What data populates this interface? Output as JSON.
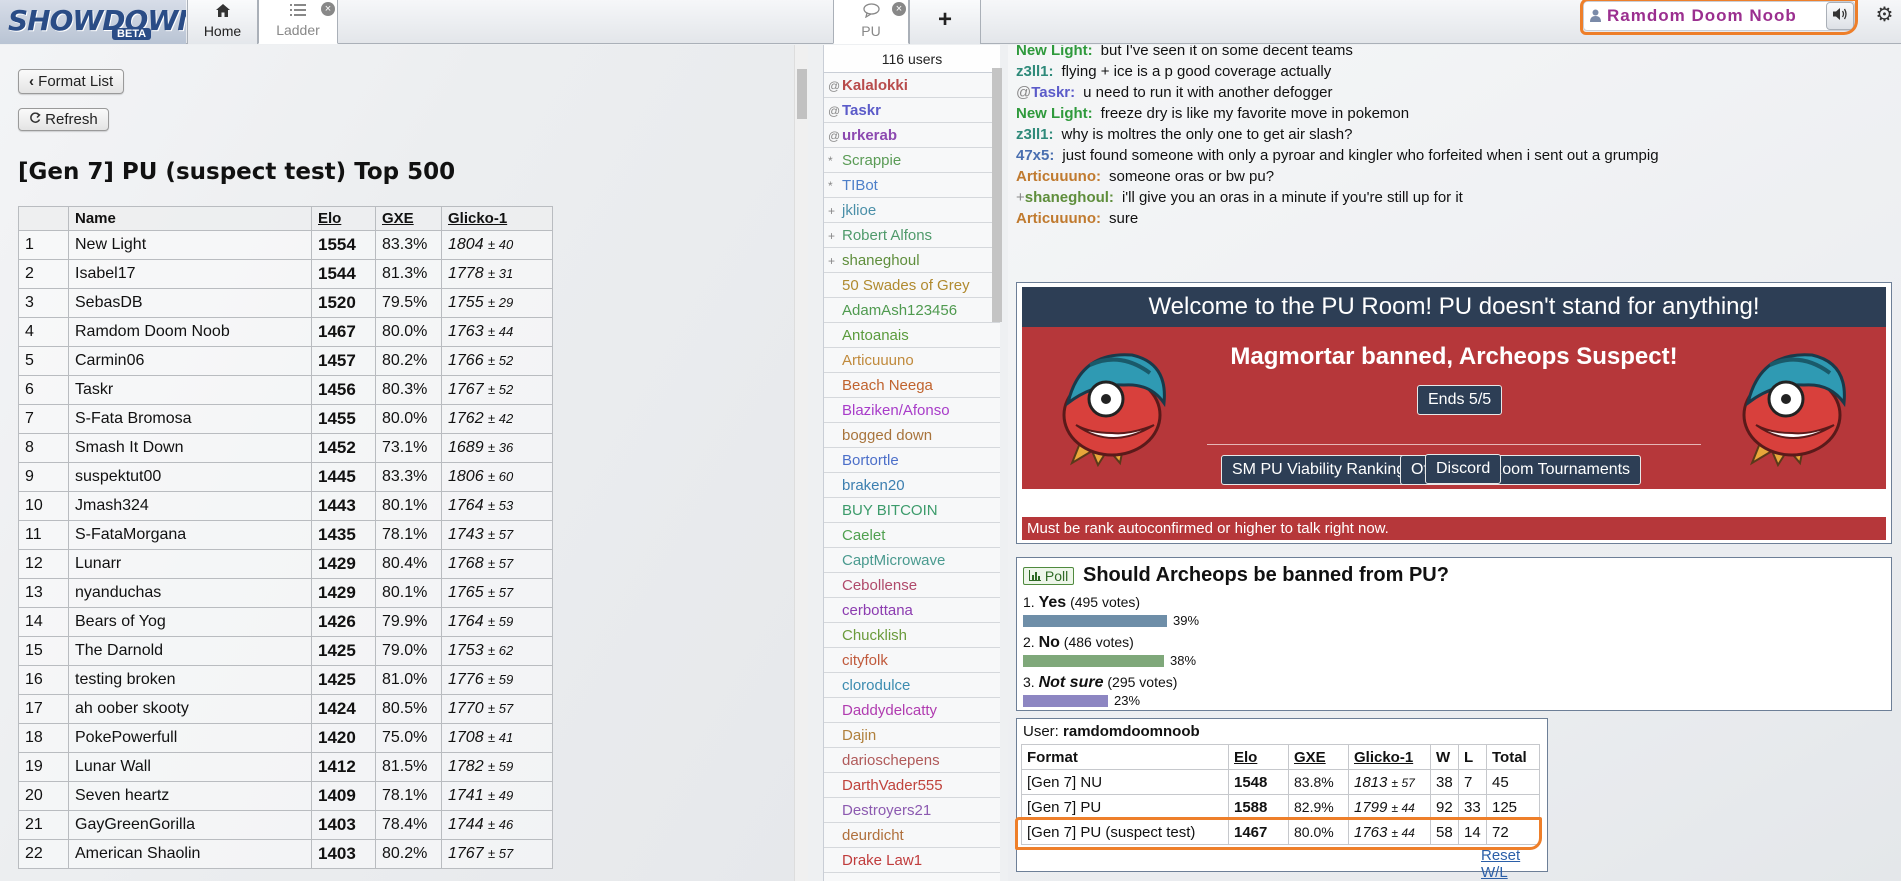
{
  "topbar": {
    "logo_text": "SHOWDOWN",
    "logo_beta": "BETA",
    "tabs": [
      {
        "label": "Home",
        "icon": "home-icon"
      },
      {
        "label": "Ladder",
        "icon": "list-icon"
      },
      {
        "label": "PU",
        "icon": "chat-bubble-icon"
      }
    ],
    "new_tab": "+",
    "user_name": "Ramdom Doom Noob",
    "volume_glyph": "🔊",
    "settings_glyph": "⚙"
  },
  "ladder": {
    "format_list_label": "Format List",
    "refresh_label": "Refresh",
    "title": "[Gen 7] PU (suspect test) Top 500",
    "headers": [
      "",
      "Name",
      "Elo",
      "GXE",
      "Glicko-1"
    ],
    "rows": [
      [
        "1",
        "New Light",
        "1554",
        "83.3%",
        "1804",
        "± 40"
      ],
      [
        "2",
        "Isabel17",
        "1544",
        "81.3%",
        "1778",
        "± 31"
      ],
      [
        "3",
        "SebasDB",
        "1520",
        "79.5%",
        "1755",
        "± 29"
      ],
      [
        "4",
        "Ramdom Doom Noob",
        "1467",
        "80.0%",
        "1763",
        "± 44"
      ],
      [
        "5",
        "Carmin06",
        "1457",
        "80.2%",
        "1766",
        "± 52"
      ],
      [
        "6",
        "Taskr",
        "1456",
        "80.3%",
        "1767",
        "± 52"
      ],
      [
        "7",
        "S-Fata Bromosa",
        "1455",
        "80.0%",
        "1762",
        "± 42"
      ],
      [
        "8",
        "Smash It Down",
        "1452",
        "73.1%",
        "1689",
        "± 36"
      ],
      [
        "9",
        "suspektut00",
        "1445",
        "83.3%",
        "1806",
        "± 60"
      ],
      [
        "10",
        "Jmash324",
        "1443",
        "80.1%",
        "1764",
        "± 53"
      ],
      [
        "11",
        "S-FataMorgana",
        "1435",
        "78.1%",
        "1743",
        "± 57"
      ],
      [
        "12",
        "Lunarr",
        "1429",
        "80.4%",
        "1768",
        "± 57"
      ],
      [
        "13",
        "nyanduchas",
        "1429",
        "80.1%",
        "1765",
        "± 57"
      ],
      [
        "14",
        "Bears of Yog",
        "1426",
        "79.9%",
        "1764",
        "± 59"
      ],
      [
        "15",
        "The Darnold",
        "1425",
        "79.0%",
        "1753",
        "± 62"
      ],
      [
        "16",
        "testing broken",
        "1425",
        "81.0%",
        "1776",
        "± 59"
      ],
      [
        "17",
        "ah oober skooty",
        "1424",
        "80.5%",
        "1770",
        "± 57"
      ],
      [
        "18",
        "PokePowerfull",
        "1420",
        "75.0%",
        "1708",
        "± 41"
      ],
      [
        "19",
        "Lunar Wall",
        "1412",
        "81.5%",
        "1782",
        "± 59"
      ],
      [
        "20",
        "Seven heartz",
        "1409",
        "78.1%",
        "1741",
        "± 49"
      ],
      [
        "21",
        "GayGreenGorilla",
        "1403",
        "78.4%",
        "1744",
        "± 46"
      ],
      [
        "22",
        "American Shaolin",
        "1403",
        "80.2%",
        "1767",
        "± 57"
      ]
    ]
  },
  "userlist": {
    "count": "116 users",
    "users": [
      {
        "rank": "@",
        "name": "Kalalokki",
        "color": "#b84c4c",
        "staff": true
      },
      {
        "rank": "@",
        "name": "Taskr",
        "color": "#5b5bc9",
        "staff": true
      },
      {
        "rank": "@",
        "name": "urkerab",
        "color": "#8c49b0",
        "staff": true
      },
      {
        "rank": "*",
        "name": "Scrappie",
        "color": "#5a9b55",
        "staff": false
      },
      {
        "rank": "*",
        "name": "TIBot",
        "color": "#4d7fc9",
        "staff": false
      },
      {
        "rank": "+",
        "name": "jklioe",
        "color": "#4a8fa8",
        "staff": false
      },
      {
        "rank": "+",
        "name": "Robert Alfons",
        "color": "#4f9a6b",
        "staff": false
      },
      {
        "rank": "+",
        "name": "shaneghoul",
        "color": "#5f8e3c",
        "staff": false
      },
      {
        "rank": "",
        "name": "50 Swades of Grey",
        "color": "#b08a2f",
        "staff": false
      },
      {
        "rank": "",
        "name": "AdamAsh123456",
        "color": "#4f9a4f",
        "staff": false
      },
      {
        "rank": "",
        "name": "Antoanais",
        "color": "#5a9b3c",
        "staff": false
      },
      {
        "rank": "",
        "name": "Articuuuno",
        "color": "#c08a3c",
        "staff": false
      },
      {
        "rank": "",
        "name": "Beach Neega",
        "color": "#c0632e",
        "staff": false
      },
      {
        "rank": "",
        "name": "Blaziken/Afonso",
        "color": "#a83cc9",
        "staff": false
      },
      {
        "rank": "",
        "name": "bogged down",
        "color": "#a8743c",
        "staff": false
      },
      {
        "rank": "",
        "name": "Bortortle",
        "color": "#4c6fc9",
        "staff": false
      },
      {
        "rank": "",
        "name": "braken20",
        "color": "#3c7fb0",
        "staff": false
      },
      {
        "rank": "",
        "name": "BUY BITCOIN",
        "color": "#3c9b6b",
        "staff": false
      },
      {
        "rank": "",
        "name": "Caelet",
        "color": "#4fa04f",
        "staff": false
      },
      {
        "rank": "",
        "name": "CaptMicrowave",
        "color": "#4a9a8f",
        "staff": false
      },
      {
        "rank": "",
        "name": "Cebollense",
        "color": "#b04a6b",
        "staff": false
      },
      {
        "rank": "",
        "name": "cerbottana",
        "color": "#8c3cb0",
        "staff": false
      },
      {
        "rank": "",
        "name": "Chucklish",
        "color": "#6b9b3c",
        "staff": false
      },
      {
        "rank": "",
        "name": "cityfolk",
        "color": "#c05a3c",
        "staff": false
      },
      {
        "rank": "",
        "name": "clorodulce",
        "color": "#3c8cb0",
        "staff": false
      },
      {
        "rank": "",
        "name": "Daddydelcatty",
        "color": "#b03cb0",
        "staff": false
      },
      {
        "rank": "",
        "name": "Dajin",
        "color": "#b0803c",
        "staff": false
      },
      {
        "rank": "",
        "name": "darioschepens",
        "color": "#b05a5a",
        "staff": false
      },
      {
        "rank": "",
        "name": "DarthVader555",
        "color": "#c0433c",
        "staff": false
      },
      {
        "rank": "",
        "name": "Destroyers21",
        "color": "#8c5ab0",
        "staff": false
      },
      {
        "rank": "",
        "name": "deurdicht",
        "color": "#b0703c",
        "staff": false
      },
      {
        "rank": "",
        "name": "Drake Law1",
        "color": "#c03c3c",
        "staff": false
      }
    ]
  },
  "chat": {
    "messages": [
      {
        "rank": "",
        "who": "New Light:",
        "color": "#2f9a3c",
        "text": "but I've seen it on some decent teams"
      },
      {
        "rank": "",
        "who": "z3ll1:",
        "color": "#2f8a7a",
        "text": "flying + ice is a p good coverage actually"
      },
      {
        "rank": "@",
        "who": "Taskr:",
        "color": "#5b5bc9",
        "text": "u need to run it with another defogger"
      },
      {
        "rank": "",
        "who": "New Light:",
        "color": "#2f9a3c",
        "text": "freeze dry is like my favorite move in pokemon"
      },
      {
        "rank": "",
        "who": "z3ll1:",
        "color": "#2f8a7a",
        "text": "why is moltres the only one to get air slash?"
      },
      {
        "rank": "",
        "who": "47x5:",
        "color": "#4a6fb0",
        "text": "just found someone with only a pyroar and kingler who forfeited when i sent out a grumpig"
      },
      {
        "rank": "",
        "who": "Articuuuno:",
        "color": "#c07a2f",
        "text": "someone oras or bw pu?"
      },
      {
        "rank": "+",
        "who": "shaneghoul:",
        "color": "#5f8e3c",
        "text": "i'll give you an oras in a minute if you're still up for it"
      },
      {
        "rank": "",
        "who": "Articuuuno:",
        "color": "#c07a2f",
        "text": "sure"
      }
    ],
    "welcome": {
      "header": "Welcome to the PU Room! PU doesn't stand for anything!",
      "subheader": "Magmortar banned, Archeops Suspect!",
      "ends_label": "Ends 5/5",
      "viability_label": "SM PU Viability Rankings",
      "tournaments_label": "Official PU Room Tournaments",
      "discord_label": "Discord"
    },
    "autoconfirm_notice": "Must be rank autoconfirmed or higher to talk right now.",
    "poll": {
      "tag": "Poll",
      "question": "Should Archeops be banned from PU?",
      "options": [
        {
          "num": "1.",
          "label": "Yes",
          "votes": "(495 votes)",
          "percent": "39%",
          "fraction": 0.39,
          "color": "#6e8ea8",
          "italic": false
        },
        {
          "num": "2.",
          "label": "No",
          "votes": "(486 votes)",
          "percent": "38%",
          "fraction": 0.38,
          "color": "#7fa87a",
          "italic": false
        },
        {
          "num": "3.",
          "label": "Not sure",
          "votes": "(295 votes)",
          "percent": "23%",
          "fraction": 0.23,
          "color": "#8d86c2",
          "italic": true
        }
      ]
    },
    "user_stats": {
      "user_label": "User:",
      "user_name": "ramdomdoomnoob",
      "headers": [
        "Format",
        "Elo",
        "GXE",
        "Glicko-1",
        "W",
        "L",
        "Total"
      ],
      "rows": [
        [
          "[Gen 7] NU",
          "1548",
          "83.8%",
          "1813",
          "± 57",
          "38",
          "7",
          "45"
        ],
        [
          "[Gen 7] PU",
          "1588",
          "82.9%",
          "1799",
          "± 44",
          "92",
          "33",
          "125"
        ],
        [
          "[Gen 7] PU (suspect test)",
          "1467",
          "80.0%",
          "1763",
          "± 44",
          "58",
          "14",
          "72"
        ]
      ],
      "reset_label": "Reset W/L"
    }
  },
  "colors": {
    "accent_orange": "#ee7f2a",
    "welcome_red": "#b6373a",
    "welcome_navy": "#2d3e55",
    "username_purple": "#9b2f8f"
  }
}
